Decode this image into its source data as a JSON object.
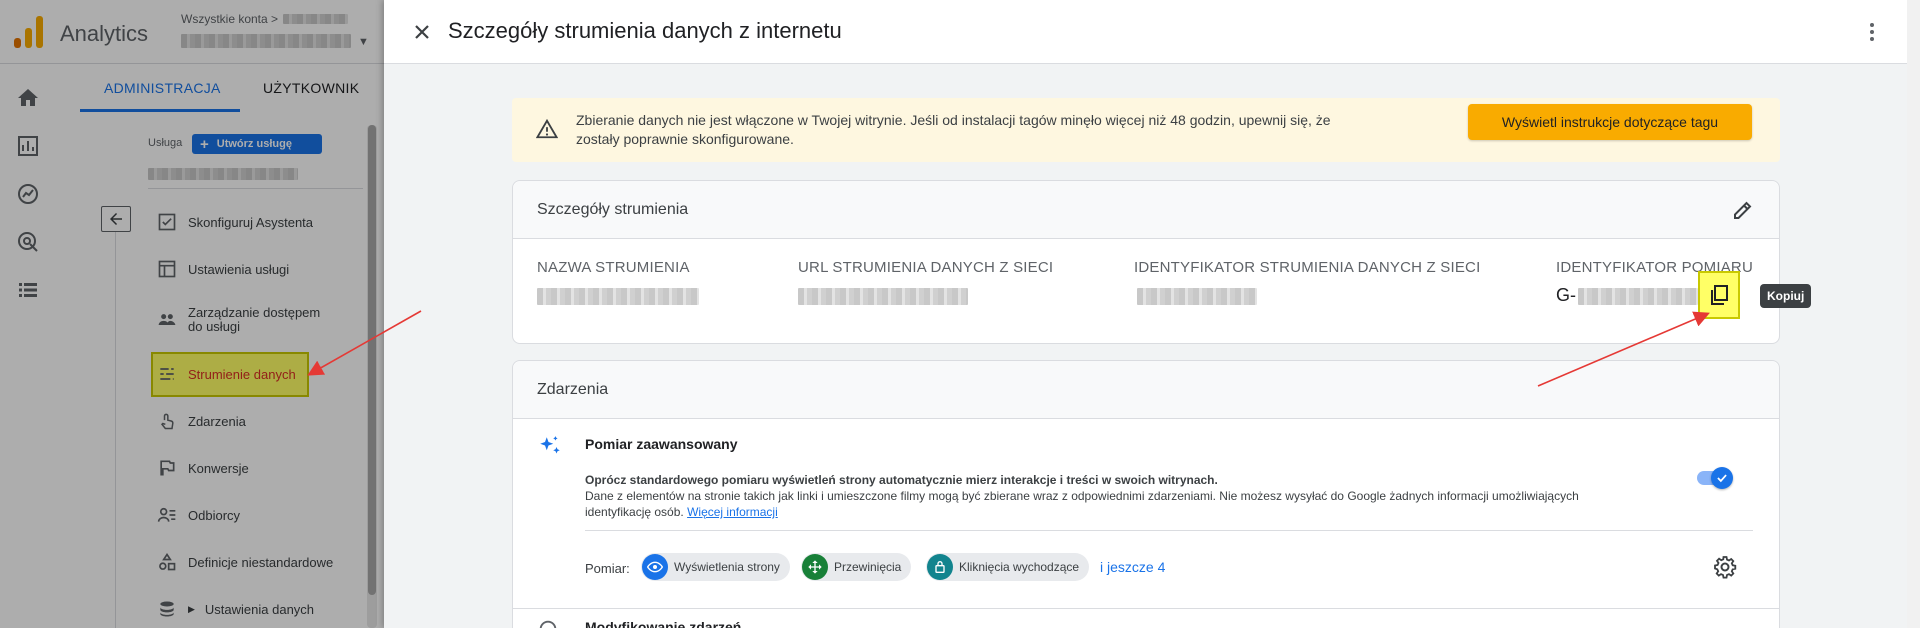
{
  "app": {
    "name": "Analytics",
    "account_prefix": "Wszystkie konta >"
  },
  "tabs": {
    "admin": "ADMINISTRACJA",
    "user": "UŻYTKOWNIK"
  },
  "service": {
    "label": "Usługa",
    "create_button": "Utwórz usługę"
  },
  "nav": {
    "items": [
      {
        "label": "Skonfiguruj Asystenta",
        "icon": "checklist-icon"
      },
      {
        "label": "Ustawienia usługi",
        "icon": "window-icon"
      },
      {
        "label": "Zarządzanie dostępem do usługi",
        "icon": "people-icon"
      },
      {
        "label": "Strumienie danych",
        "icon": "streams-icon"
      },
      {
        "label": "Zdarzenia",
        "icon": "touch-icon"
      },
      {
        "label": "Konwersje",
        "icon": "flag-icon"
      },
      {
        "label": "Odbiorcy",
        "icon": "audience-icon"
      },
      {
        "label": "Definicje niestandardowe",
        "icon": "shapes-icon"
      },
      {
        "label": "Ustawienia danych",
        "icon": "database-icon"
      }
    ]
  },
  "panel": {
    "title": "Szczegóły strumienia danych z internetu",
    "alert_text": "Zbieranie danych nie jest włączone w Twojej witrynie. Jeśli od instalacji tagów minęło więcej niż 48 godzin, upewnij się, że zostały poprawnie skonfigurowane.",
    "alert_button": "Wyświetl instrukcje dotyczące tagu"
  },
  "stream_details": {
    "title": "Szczegóły strumienia",
    "columns": [
      {
        "label": "NAZWA STRUMIENIA"
      },
      {
        "label": "URL STRUMIENIA DANYCH Z SIECI"
      },
      {
        "label": "IDENTYFIKATOR STRUMIENIA DANYCH Z SIECI"
      },
      {
        "label": "IDENTYFIKATOR POMIARU"
      }
    ],
    "measurement_prefix": "G-",
    "copy_tooltip": "Kopiuj"
  },
  "events": {
    "title": "Zdarzenia",
    "enhanced_title": "Pomiar zaawansowany",
    "enhanced_desc_1": "Oprócz standardowego pomiaru wyświetleń strony automatycznie mierz interakcje i treści w swoich witrynach.",
    "enhanced_desc_2": "Dane z elementów na stronie takich jak linki i umieszczone filmy mogą być zbierane wraz z odpowiednimi zdarzeniami. Nie możesz wysyłać do Google żadnych informacji umożliwiających identyfikację osób.",
    "more_info": "Więcej informacji",
    "toggle_on": true,
    "measure_label": "Pomiar:",
    "chips": [
      {
        "label": "Wyświetlenia strony",
        "icon": "eye-icon",
        "color": "#1a73e8"
      },
      {
        "label": "Przewinięcia",
        "icon": "scroll-icon",
        "color": "#188038"
      },
      {
        "label": "Kliknięcia wychodzące",
        "icon": "lock-icon",
        "color": "#12848e"
      }
    ],
    "more_chips": "i jeszcze 4",
    "modify_title": "Modyfikowanie zdarzeń"
  },
  "colors": {
    "accent": "#1a73e8",
    "warning_bg": "#fef7e0",
    "warning_button": "#f9ab00",
    "highlight": "#ffff66",
    "annotation_arrow": "#e53935"
  }
}
